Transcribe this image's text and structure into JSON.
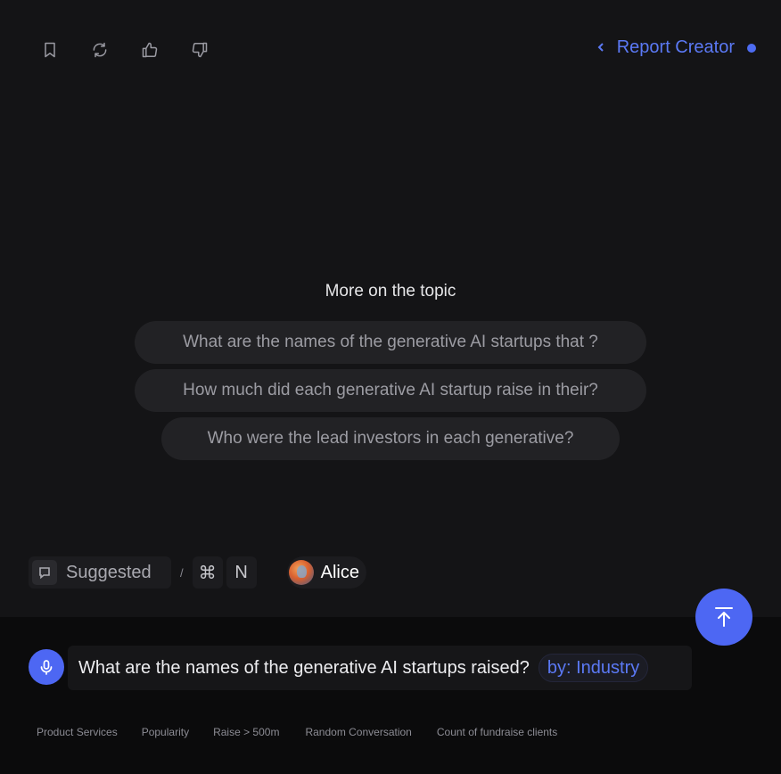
{
  "toolbar": {
    "icons": [
      "bookmark-icon",
      "refresh-icon",
      "thumbs-up-icon",
      "thumbs-down-icon"
    ]
  },
  "header": {
    "report_label": "Report Creator",
    "accent_color": "#4d67f3"
  },
  "topic": {
    "title": "More on the topic",
    "suggestions": [
      "What are the names of the generative AI startups that ?",
      "How much did each generative AI startup raise in their?",
      "Who were the lead investors in each generative?"
    ]
  },
  "bottom_bar": {
    "suggested_label": "Suggested",
    "separator": "/",
    "shortcut_keys": [
      "⌘",
      "N"
    ],
    "user_name": "Alice"
  },
  "composer": {
    "query": "What are the names of the generative AI startups raised?",
    "filter_tag": "by: Industry"
  },
  "quick_links": [
    "Product Services",
    "Popularity",
    "Raise > 500m",
    "Random Conversation",
    "Count of fundraise clients"
  ]
}
